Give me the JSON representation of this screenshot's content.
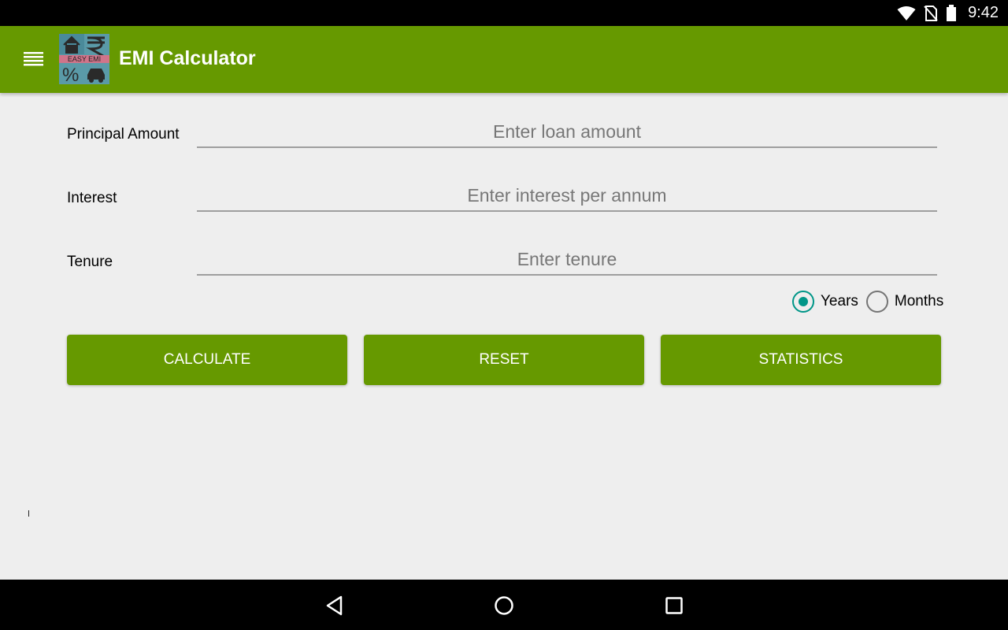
{
  "status_bar": {
    "time": "9:42",
    "icons": [
      "wifi-icon",
      "no-sim-icon",
      "battery-icon"
    ]
  },
  "app_bar": {
    "title": "EMI Calculator",
    "logo_text": "EASY EMI",
    "menu_icon": "hamburger-menu-icon",
    "color": "#669900"
  },
  "form": {
    "principal": {
      "label": "Principal Amount",
      "placeholder": "Enter loan amount",
      "value": ""
    },
    "interest": {
      "label": "Interest",
      "placeholder": "Enter interest per annum",
      "value": ""
    },
    "tenure": {
      "label": "Tenure",
      "placeholder": "Enter tenure",
      "value": ""
    },
    "tenure_unit": {
      "options": [
        {
          "label": "Years",
          "selected": true
        },
        {
          "label": "Months",
          "selected": false
        }
      ]
    }
  },
  "buttons": {
    "calculate": "CALCULATE",
    "reset": "RESET",
    "statistics": "STATISTICS"
  },
  "nav_bar": {
    "icons": [
      "back-icon",
      "home-icon",
      "recents-icon"
    ]
  },
  "colors": {
    "primary": "#669900",
    "accent": "#009688",
    "background": "#eeeeee"
  }
}
